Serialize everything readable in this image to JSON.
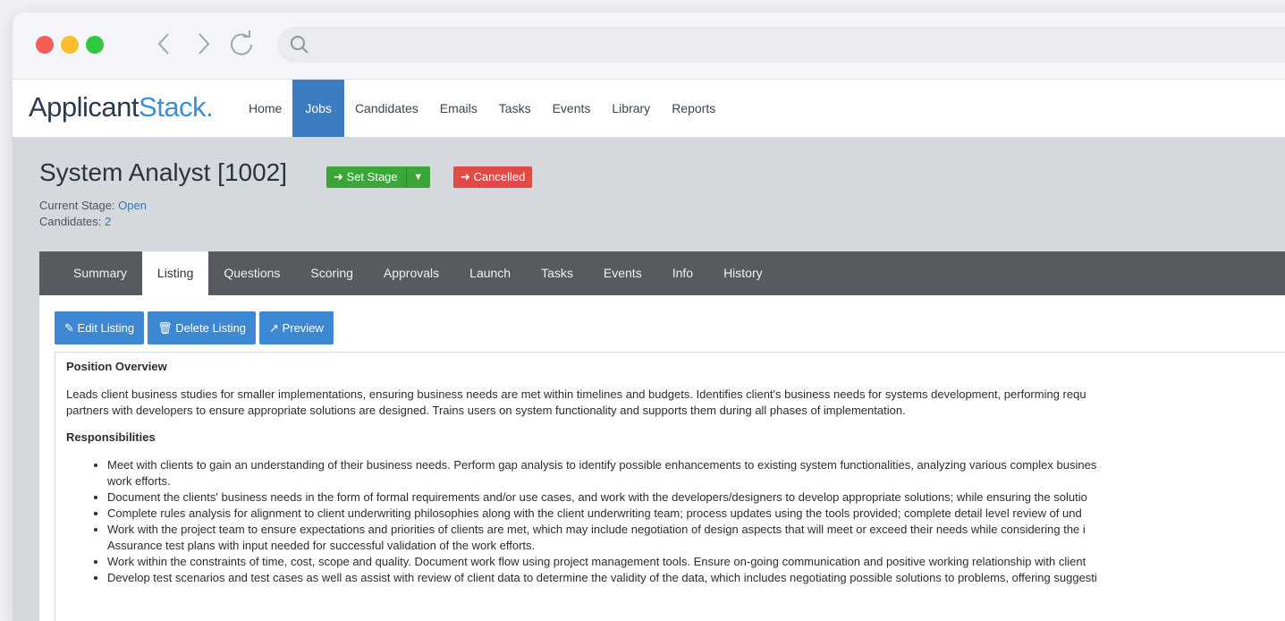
{
  "app": {
    "logo_dark": "Applicant",
    "logo_accent": "Stack",
    "logo_period": "."
  },
  "nav": [
    "Home",
    "Jobs",
    "Candidates",
    "Emails",
    "Tasks",
    "Events",
    "Library",
    "Reports"
  ],
  "nav_active": "Jobs",
  "job": {
    "title": "System Analyst [1002]",
    "set_stage_label": "Set Stage",
    "cancelled_label": "Cancelled",
    "current_stage_label": "Current Stage:",
    "current_stage_value": "Open",
    "candidates_label": "Candidates:",
    "candidates_value": "2"
  },
  "tabs": [
    "Summary",
    "Listing",
    "Questions",
    "Scoring",
    "Approvals",
    "Launch",
    "Tasks",
    "Events",
    "Info",
    "History"
  ],
  "tab_active": "Listing",
  "actions": {
    "edit": "Edit Listing",
    "delete": "Delete Listing",
    "preview": "Preview"
  },
  "listing": {
    "overview_heading": "Position Overview",
    "overview_line1": "Leads client business studies for smaller implementations, ensuring business needs are met within timelines and budgets. Identifies client's business needs for systems development, performing requ",
    "overview_line2": "partners with developers to ensure appropriate solutions are designed. Trains users on system functionality and supports them during all phases of implementation.",
    "responsibilities_heading": "Responsibilities",
    "bullets": [
      [
        "Meet with clients to gain an understanding of their business needs. Perform gap analysis to identify possible enhancements to existing system functionalities, analyzing various complex busines",
        "work efforts."
      ],
      [
        "Document the clients' business needs in the form of formal requirements and/or use cases, and work with the developers/designers to develop appropriate solutions; while ensuring the solutio"
      ],
      [
        "Complete rules analysis for alignment to client underwriting philosophies along with the client underwriting team; process updates using the tools provided; complete detail level review of und"
      ],
      [
        "Work with the project team to ensure expectations and priorities of clients are met, which may include negotiation of design aspects that will meet or exceed their needs while considering the i",
        "Assurance test plans with input needed for successful validation of the work efforts."
      ],
      [
        "Work within the constraints of time, cost, scope and quality. Document work flow using project management tools. Ensure on-going communication and positive working relationship with client"
      ],
      [
        "Develop test scenarios and test cases as well as assist with review of client data to determine the validity of the data, which includes negotiating possible solutions to problems, offering suggesti"
      ]
    ]
  },
  "colors": {
    "nav_active": "#3c7cc1",
    "set_stage": "#3aa638",
    "cancelled": "#e14a46",
    "action_button": "#3c88d3",
    "tabbar": "#575a5e",
    "link": "#2f77c1"
  }
}
